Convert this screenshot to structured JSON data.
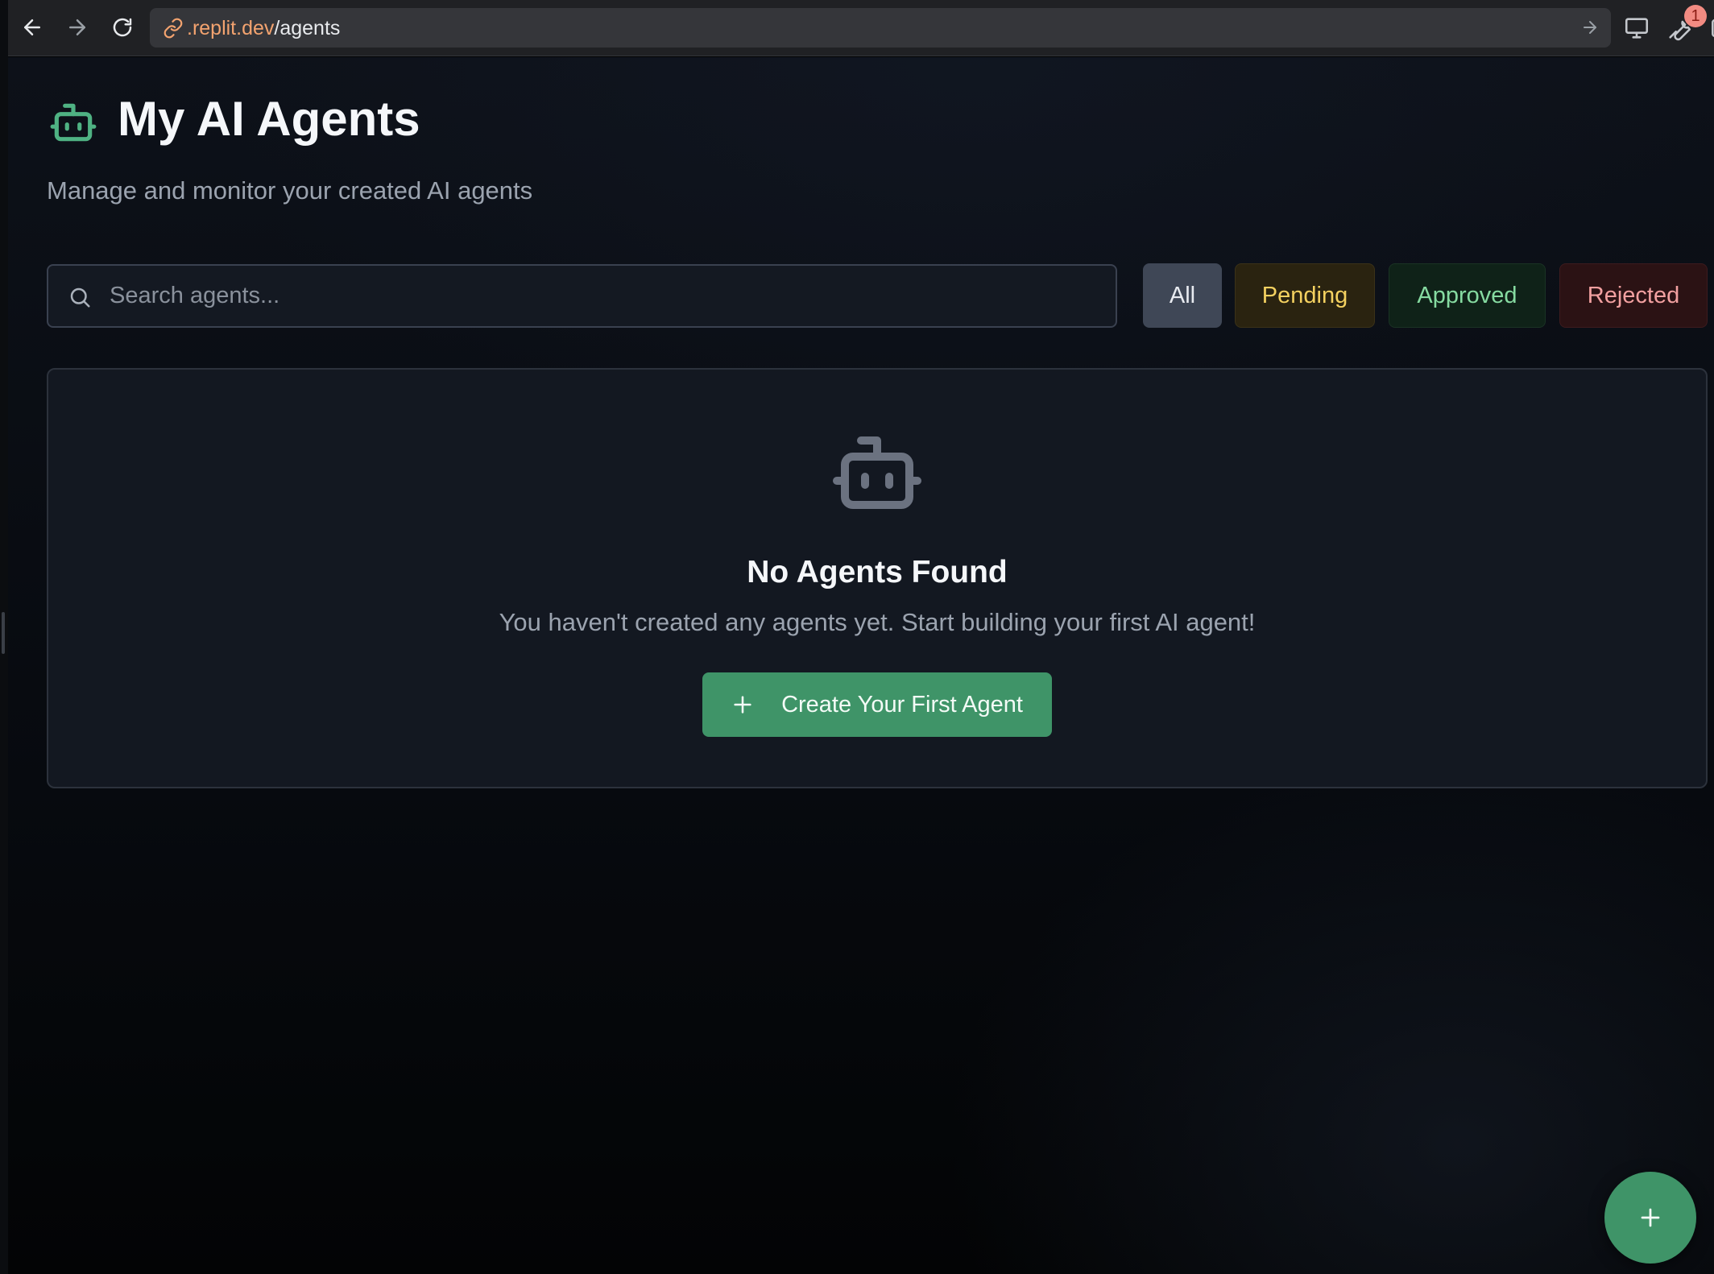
{
  "browser": {
    "url_domain": ".replit.dev",
    "url_path": "/agents",
    "notification_count": "1"
  },
  "header": {
    "title": "My AI Agents",
    "subtitle": "Manage and monitor your created AI agents"
  },
  "search": {
    "placeholder": "Search agents...",
    "value": ""
  },
  "filters": {
    "all": "All",
    "pending": "Pending",
    "approved": "Approved",
    "rejected": "Rejected",
    "selected": "All"
  },
  "empty_state": {
    "title": "No Agents Found",
    "description": "You haven't created any agents yet. Start building your first AI agent!",
    "cta_label": "Create Your First Agent"
  },
  "icons": {
    "header": "bot-icon",
    "empty": "bot-icon",
    "search": "search-icon",
    "create": "plus-icon",
    "fab": "plus-icon"
  },
  "colors": {
    "accent": "#3f9468",
    "header_icon": "#4fb283",
    "pending": "#f4d160",
    "approved": "#86dba1",
    "rejected": "#f2a0a0"
  }
}
